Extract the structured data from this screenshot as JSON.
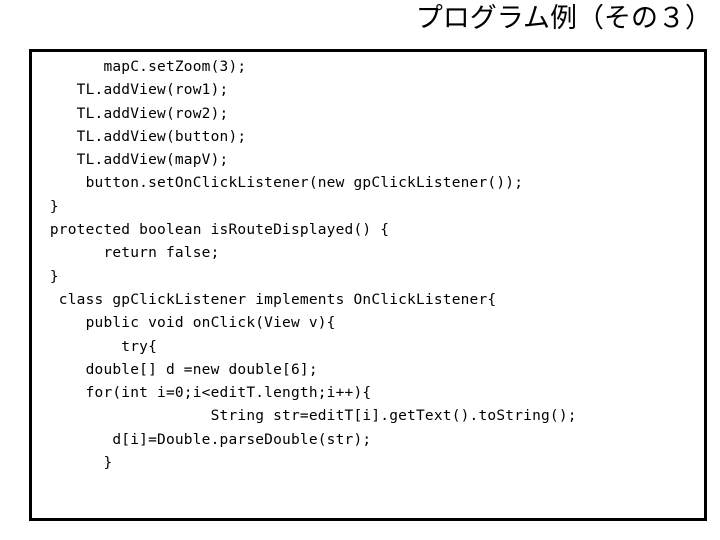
{
  "slide": {
    "title": "プログラム例（その３）",
    "background_color": "#ffffff",
    "text_color": "#000000",
    "frame_border_color": "#000000"
  },
  "code_block": {
    "language": "java",
    "lines": [
      "        mapC.setZoom(3);",
      "     TL.addView(row1);",
      "     TL.addView(row2);",
      "     TL.addView(button);",
      "     TL.addView(mapV);",
      "      button.setOnClickListener(new gpClickListener());",
      "  }",
      "  protected boolean isRouteDisplayed() {",
      "        return false;",
      "  }",
      "   class gpClickListener implements OnClickListener{",
      "      public void onClick(View v){",
      "          try{",
      "      double[] d =new double[6];",
      "      for(int i=0;i<editT.length;i++){",
      "                    String str=editT[i].getText().toString();",
      "         d[i]=Double.parseDouble(str);",
      "        }"
    ]
  }
}
